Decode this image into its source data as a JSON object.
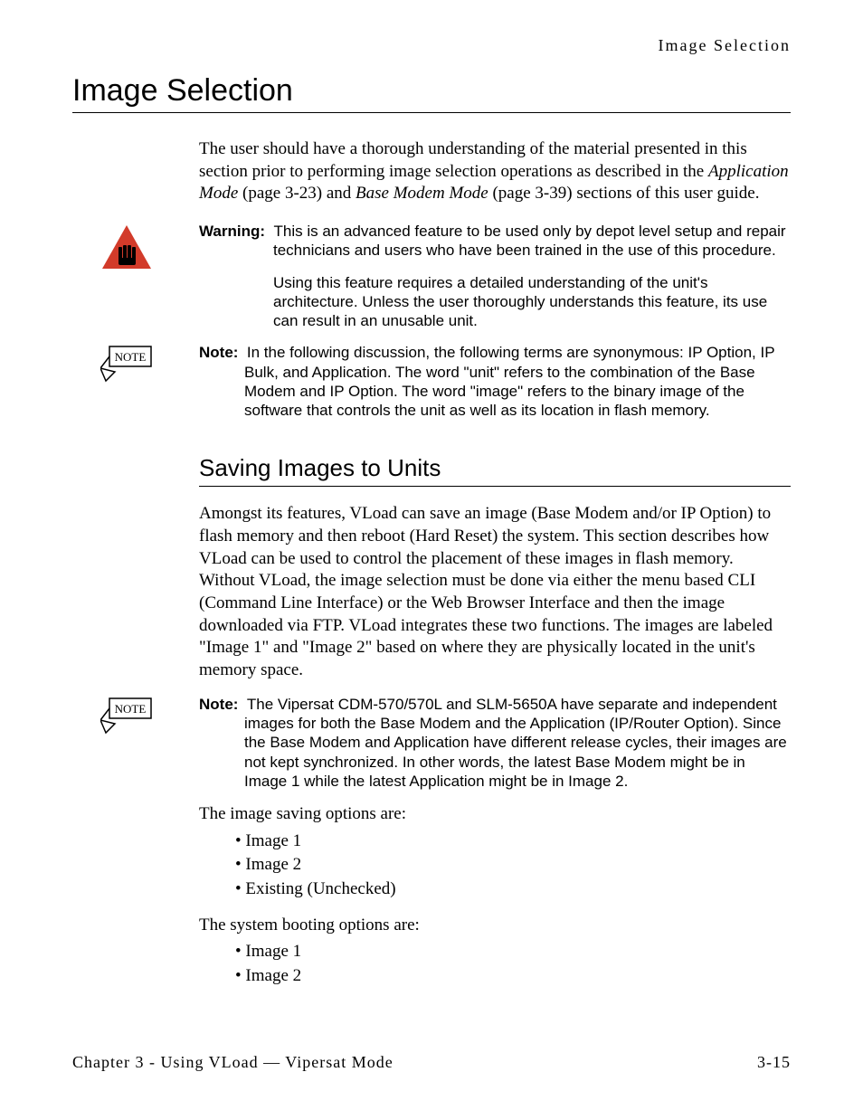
{
  "running_header": "Image Selection",
  "title": "Image Selection",
  "intro": {
    "pre": "The user should have a thorough understanding of the material presented in this section prior to performing image selection operations as described in the ",
    "link1": "Application Mode",
    "link1_page": " (page 3-23) and ",
    "link2": "Base Modem Mode",
    "link2_page": " (page 3-39) sections of this user guide."
  },
  "warning": {
    "label": "Warning:",
    "p1": "This is an advanced feature to be used only by depot level setup and repair technicians and users who have been trained in the use of this procedure.",
    "p2": "Using this feature requires a detailed understanding of the unit's architecture. Unless the user thoroughly understands this feature, its use can result in an unusable unit."
  },
  "note1": {
    "label": "Note:",
    "p1": "In the following discussion, the following terms are synonymous: IP Option, IP Bulk, and Application. The word \"unit\" refers to the combination of the Base Modem and IP Option. The word \"image\" refers to the binary image of the software that controls the unit as well as its location in flash memory."
  },
  "subsection": "Saving Images to Units",
  "saving_para": "Amongst its features, VLoad can save an image (Base Modem and/or IP Option) to flash memory and then reboot (Hard Reset) the system. This section describes how VLoad can be used to control the placement of these images in flash memory. Without VLoad, the image selection must be done via either the menu based CLI (Command Line Interface) or the Web Browser Interface and then the image downloaded via FTP. VLoad integrates these two functions. The images are labeled \"Image 1\" and \"Image 2\" based on where they are physically located in the unit's memory space.",
  "note2": {
    "label": "Note:",
    "p1": "The Vipersat CDM-570/570L and SLM-5650A have separate and independent images for both the Base Modem and the Application (IP/Router Option). Since the Base Modem and Application have different release cycles, their images are not kept synchronized. In other words, the latest Base Modem might be in Image 1 while the latest Application might be in Image 2."
  },
  "saving_options_lead": "The image saving options are:",
  "saving_options": [
    "Image 1",
    "Image 2",
    "Existing (Unchecked)"
  ],
  "boot_options_lead": "The system booting options are:",
  "boot_options": [
    "Image 1",
    "Image 2"
  ],
  "footer_left": "Chapter 3 - Using VLoad — Vipersat Mode",
  "footer_right": "3-15",
  "icons": {
    "note_label": "NOTE"
  }
}
